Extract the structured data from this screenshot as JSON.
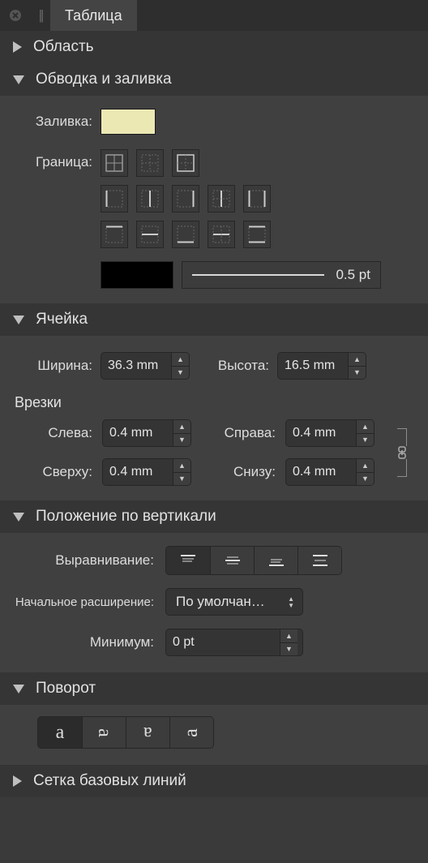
{
  "tab": {
    "title": "Таблица"
  },
  "sections": {
    "region": "Область",
    "stroke_fill": "Обводка и заливка",
    "cell": "Ячейка",
    "vpos": "Положение по вертикали",
    "rotation": "Поворот",
    "baseline": "Сетка базовых линий"
  },
  "fill": {
    "label": "Заливка:",
    "color": "#ece8b3"
  },
  "border": {
    "label": "Граница:",
    "line_color": "#000000",
    "line_weight": "0.5 pt"
  },
  "cell": {
    "width_label": "Ширина:",
    "width": "36.3 mm",
    "height_label": "Высота:",
    "height": "16.5 mm",
    "insets_label": "Врезки",
    "left_label": "Слева:",
    "left": "0.4 mm",
    "right_label": "Справа:",
    "right": "0.4 mm",
    "top_label": "Сверху:",
    "top": "0.4 mm",
    "bottom_label": "Снизу:",
    "bottom": "0.4 mm"
  },
  "vpos": {
    "align_label": "Выравнивание:",
    "expand_label": "Начальное расширение:",
    "expand_value": "По умолчан…",
    "min_label": "Минимум:",
    "min_value": "0 pt"
  },
  "rotation": {
    "glyphs": [
      "a",
      "a",
      "a",
      "a"
    ]
  }
}
